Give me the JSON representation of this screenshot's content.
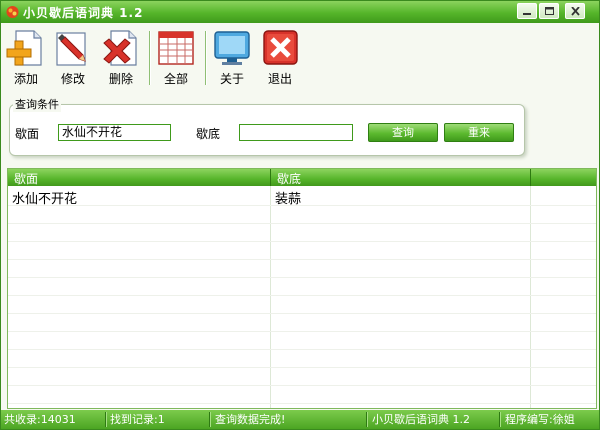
{
  "window": {
    "title": "小贝歇后语词典 1.2"
  },
  "toolbar": {
    "add": "添加",
    "edit": "修改",
    "delete": "删除",
    "all": "全部",
    "about": "关于",
    "exit": "退出"
  },
  "query": {
    "group_title": "查询条件",
    "riddle_label": "歇面",
    "riddle_value": "水仙不开花",
    "answer_label": "歇底",
    "answer_value": "",
    "search_button": "查询",
    "reset_button": "重来"
  },
  "table": {
    "columns": [
      "歇面",
      "歇底"
    ],
    "rows": [
      [
        "水仙不开花",
        "装蒜"
      ]
    ]
  },
  "status": {
    "total": "共收录:14031",
    "found": "找到记录:1",
    "message": "查询数据完成!",
    "app": "小贝歇后语词典 1.2",
    "author": "程序编写:徐姐"
  },
  "colors": {
    "accent": "#55b52a",
    "header_green": "#41991c",
    "border": "#3f9a1b"
  }
}
